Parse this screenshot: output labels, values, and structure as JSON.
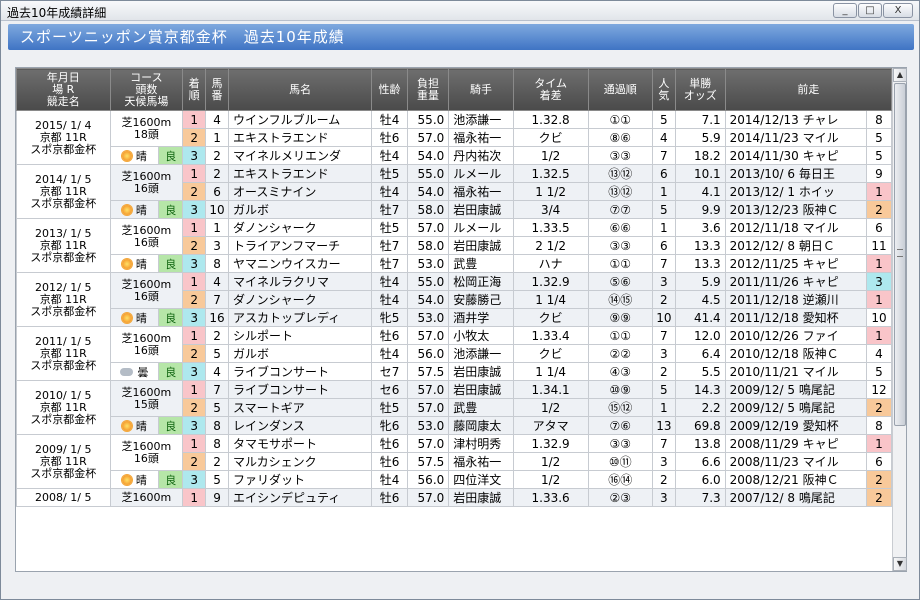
{
  "window": {
    "title": "過去10年成績詳細",
    "minimize": "_",
    "maximize": "□",
    "close": "X"
  },
  "banner": {
    "text": "スポーツニッポン賞京都金杯　過去10年成績"
  },
  "headers": {
    "race": "年月日\n場 R\n競走名",
    "course": "コース\n頭数\n天候馬場",
    "rank": "着\n順",
    "num": "馬\n番",
    "name": "馬名",
    "age": "性齢",
    "weight": "負担\n重量",
    "jockey": "騎手",
    "time": "タイム\n着差",
    "pass": "通過順",
    "pop": "人\n気",
    "odds": "単勝\nオッズ",
    "prev": "前走"
  },
  "races": [
    {
      "date": "2015/ 1/ 4",
      "place": "京都 11R",
      "race": "スポ京都金杯",
      "course": "芝1600m",
      "heads": "18頭",
      "weather": "晴",
      "weather_icon": "sun",
      "track": "良",
      "rows": [
        {
          "rank": "1",
          "num": "4",
          "name": "ウインフルブルーム",
          "age": "牡4",
          "weight": "55.0",
          "jockey": "池添謙一",
          "time": "1.32.8",
          "pass": "①①",
          "pop": "5",
          "odds": "7.1",
          "prev_date": "2014/12/13",
          "prev_race": "チャレ",
          "prev_rank": "8"
        },
        {
          "rank": "2",
          "num": "1",
          "name": "エキストラエンド",
          "age": "牡6",
          "weight": "57.0",
          "jockey": "福永祐一",
          "time": "クビ",
          "pass": "⑧⑥",
          "pop": "4",
          "odds": "5.9",
          "prev_date": "2014/11/23",
          "prev_race": "マイル",
          "prev_rank": "5"
        },
        {
          "rank": "3",
          "num": "2",
          "name": "マイネルメリエンダ",
          "age": "牡4",
          "weight": "54.0",
          "jockey": "丹内祐次",
          "time": "1/2",
          "pass": "③③",
          "pop": "7",
          "odds": "18.2",
          "prev_date": "2014/11/30",
          "prev_race": "キャピ",
          "prev_rank": "5"
        }
      ]
    },
    {
      "date": "2014/ 1/ 5",
      "place": "京都 11R",
      "race": "スポ京都金杯",
      "course": "芝1600m",
      "heads": "16頭",
      "weather": "晴",
      "weather_icon": "sun",
      "track": "良",
      "rows": [
        {
          "rank": "1",
          "num": "2",
          "name": "エキストラエンド",
          "age": "牡5",
          "weight": "55.0",
          "jockey": "ルメール",
          "time": "1.32.5",
          "pass": "⑬⑫",
          "pop": "6",
          "odds": "10.1",
          "prev_date": "2013/10/ 6",
          "prev_race": "毎日王",
          "prev_rank": "9"
        },
        {
          "rank": "2",
          "num": "6",
          "name": "オースミナイン",
          "age": "牡4",
          "weight": "54.0",
          "jockey": "福永祐一",
          "time": "1 1/2",
          "pass": "⑬⑫",
          "pop": "1",
          "odds": "4.1",
          "prev_date": "2013/12/ 1",
          "prev_race": "ホイッ",
          "prev_rank": "1"
        },
        {
          "rank": "3",
          "num": "10",
          "name": "ガルボ",
          "age": "牡7",
          "weight": "58.0",
          "jockey": "岩田康誠",
          "time": "3/4",
          "pass": "⑦⑦",
          "pop": "5",
          "odds": "9.9",
          "prev_date": "2013/12/23",
          "prev_race": "阪神Ｃ",
          "prev_rank": "2"
        }
      ]
    },
    {
      "date": "2013/ 1/ 5",
      "place": "京都 11R",
      "race": "スポ京都金杯",
      "course": "芝1600m",
      "heads": "16頭",
      "weather": "晴",
      "weather_icon": "sun",
      "track": "良",
      "rows": [
        {
          "rank": "1",
          "num": "1",
          "name": "ダノンシャーク",
          "age": "牡5",
          "weight": "57.0",
          "jockey": "ルメール",
          "time": "1.33.5",
          "pass": "⑥⑥",
          "pop": "1",
          "odds": "3.6",
          "prev_date": "2012/11/18",
          "prev_race": "マイル",
          "prev_rank": "6"
        },
        {
          "rank": "2",
          "num": "3",
          "name": "トライアンフマーチ",
          "age": "牡7",
          "weight": "58.0",
          "jockey": "岩田康誠",
          "time": "2 1/2",
          "pass": "③③",
          "pop": "6",
          "odds": "13.3",
          "prev_date": "2012/12/ 8",
          "prev_race": "朝日Ｃ",
          "prev_rank": "11"
        },
        {
          "rank": "3",
          "num": "8",
          "name": "ヤマニンウイスカー",
          "age": "牡7",
          "weight": "53.0",
          "jockey": "武豊",
          "time": "ハナ",
          "pass": "①①",
          "pop": "7",
          "odds": "13.3",
          "prev_date": "2012/11/25",
          "prev_race": "キャピ",
          "prev_rank": "1"
        }
      ]
    },
    {
      "date": "2012/ 1/ 5",
      "place": "京都 11R",
      "race": "スポ京都金杯",
      "course": "芝1600m",
      "heads": "16頭",
      "weather": "晴",
      "weather_icon": "sun",
      "track": "良",
      "rows": [
        {
          "rank": "1",
          "num": "4",
          "name": "マイネルラクリマ",
          "age": "牡4",
          "weight": "55.0",
          "jockey": "松岡正海",
          "time": "1.32.9",
          "pass": "⑤⑥",
          "pop": "3",
          "odds": "5.9",
          "prev_date": "2011/11/26",
          "prev_race": "キャピ",
          "prev_rank": "3"
        },
        {
          "rank": "2",
          "num": "7",
          "name": "ダノンシャーク",
          "age": "牡4",
          "weight": "54.0",
          "jockey": "安藤勝己",
          "time": "1 1/4",
          "pass": "⑭⑮",
          "pop": "2",
          "odds": "4.5",
          "prev_date": "2011/12/18",
          "prev_race": "逆瀬川",
          "prev_rank": "1"
        },
        {
          "rank": "3",
          "num": "16",
          "name": "アスカトップレディ",
          "age": "牝5",
          "weight": "53.0",
          "jockey": "酒井学",
          "time": "クビ",
          "pass": "⑨⑨",
          "pop": "10",
          "odds": "41.4",
          "prev_date": "2011/12/18",
          "prev_race": "愛知杯",
          "prev_rank": "10"
        }
      ]
    },
    {
      "date": "2011/ 1/ 5",
      "place": "京都 11R",
      "race": "スポ京都金杯",
      "course": "芝1600m",
      "heads": "16頭",
      "weather": "曇",
      "weather_icon": "cloud",
      "track": "良",
      "rows": [
        {
          "rank": "1",
          "num": "2",
          "name": "シルポート",
          "age": "牡6",
          "weight": "57.0",
          "jockey": "小牧太",
          "time": "1.33.4",
          "pass": "①①",
          "pop": "7",
          "odds": "12.0",
          "prev_date": "2010/12/26",
          "prev_race": "ファイ",
          "prev_rank": "1"
        },
        {
          "rank": "2",
          "num": "5",
          "name": "ガルボ",
          "age": "牡4",
          "weight": "56.0",
          "jockey": "池添謙一",
          "time": "クビ",
          "pass": "②②",
          "pop": "3",
          "odds": "6.4",
          "prev_date": "2010/12/18",
          "prev_race": "阪神Ｃ",
          "prev_rank": "4"
        },
        {
          "rank": "3",
          "num": "4",
          "name": "ライブコンサート",
          "age": "セ7",
          "weight": "57.5",
          "jockey": "岩田康誠",
          "time": "1 1/4",
          "pass": "④③",
          "pop": "2",
          "odds": "5.5",
          "prev_date": "2010/11/21",
          "prev_race": "マイル",
          "prev_rank": "5"
        }
      ]
    },
    {
      "date": "2010/ 1/ 5",
      "place": "京都 11R",
      "race": "スポ京都金杯",
      "course": "芝1600m",
      "heads": "15頭",
      "weather": "晴",
      "weather_icon": "sun",
      "track": "良",
      "rows": [
        {
          "rank": "1",
          "num": "7",
          "name": "ライブコンサート",
          "age": "セ6",
          "weight": "57.0",
          "jockey": "岩田康誠",
          "time": "1.34.1",
          "pass": "⑩⑨",
          "pop": "5",
          "odds": "14.3",
          "prev_date": "2009/12/ 5",
          "prev_race": "鳴尾記",
          "prev_rank": "12"
        },
        {
          "rank": "2",
          "num": "5",
          "name": "スマートギア",
          "age": "牡5",
          "weight": "57.0",
          "jockey": "武豊",
          "time": "1/2",
          "pass": "⑮⑫",
          "pop": "1",
          "odds": "2.2",
          "prev_date": "2009/12/ 5",
          "prev_race": "鳴尾記",
          "prev_rank": "2"
        },
        {
          "rank": "3",
          "num": "8",
          "name": "レインダンス",
          "age": "牝6",
          "weight": "53.0",
          "jockey": "藤岡康太",
          "time": "アタマ",
          "pass": "⑦⑥",
          "pop": "13",
          "odds": "69.8",
          "prev_date": "2009/12/19",
          "prev_race": "愛知杯",
          "prev_rank": "8"
        }
      ]
    },
    {
      "date": "2009/ 1/ 5",
      "place": "京都 11R",
      "race": "スポ京都金杯",
      "course": "芝1600m",
      "heads": "16頭",
      "weather": "晴",
      "weather_icon": "sun",
      "track": "良",
      "rows": [
        {
          "rank": "1",
          "num": "8",
          "name": "タマモサポート",
          "age": "牡6",
          "weight": "57.0",
          "jockey": "津村明秀",
          "time": "1.32.9",
          "pass": "③③",
          "pop": "7",
          "odds": "13.8",
          "prev_date": "2008/11/29",
          "prev_race": "キャピ",
          "prev_rank": "1"
        },
        {
          "rank": "2",
          "num": "2",
          "name": "マルカシェンク",
          "age": "牡6",
          "weight": "57.5",
          "jockey": "福永祐一",
          "time": "1/2",
          "pass": "⑩⑪",
          "pop": "3",
          "odds": "6.6",
          "prev_date": "2008/11/23",
          "prev_race": "マイル",
          "prev_rank": "6"
        },
        {
          "rank": "3",
          "num": "5",
          "name": "ファリダット",
          "age": "牡4",
          "weight": "56.0",
          "jockey": "四位洋文",
          "time": "1/2",
          "pass": "⑯⑭",
          "pop": "2",
          "odds": "6.0",
          "prev_date": "2008/12/21",
          "prev_race": "阪神Ｃ",
          "prev_rank": "2"
        }
      ]
    },
    {
      "date": "2008/ 1/ 5",
      "place": "",
      "race": "",
      "course": "芝1600m",
      "heads": "",
      "weather": "",
      "weather_icon": "",
      "track": "",
      "rows": [
        {
          "rank": "1",
          "num": "9",
          "name": "エイシンデピュティ",
          "age": "牡6",
          "weight": "57.0",
          "jockey": "岩田康誠",
          "time": "1.33.6",
          "pass": "②③",
          "pop": "3",
          "odds": "7.3",
          "prev_date": "2007/12/ 8",
          "prev_race": "鳴尾記",
          "prev_rank": "2"
        }
      ]
    }
  ],
  "scrollbar": {
    "up": "▲",
    "down": "▼"
  }
}
